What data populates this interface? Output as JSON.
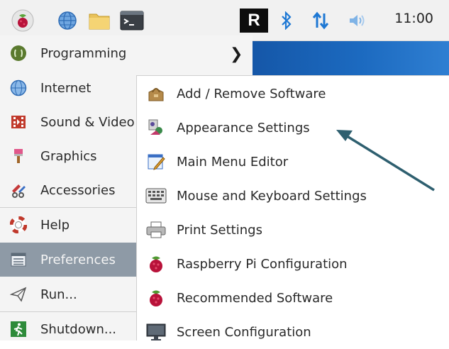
{
  "taskbar": {
    "clock": "11:00",
    "icons": [
      "raspberry-menu-icon",
      "web-browser-icon",
      "file-manager-icon",
      "terminal-icon",
      "realvnc-icon",
      "bluetooth-icon",
      "network-icon",
      "volume-icon"
    ],
    "vnc_label": "R"
  },
  "main_menu": {
    "items": [
      {
        "label": "Programming",
        "icon": "programming-icon"
      },
      {
        "label": "Internet",
        "icon": "globe-icon"
      },
      {
        "label": "Sound & Video",
        "icon": "sound-video-icon"
      },
      {
        "label": "Graphics",
        "icon": "paintbrush-icon"
      },
      {
        "label": "Accessories",
        "icon": "accessories-icon"
      },
      {
        "label": "Help",
        "icon": "lifebuoy-icon"
      },
      {
        "label": "Preferences",
        "icon": "preferences-icon"
      },
      {
        "label": "Run...",
        "icon": "paper-plane-icon"
      },
      {
        "label": "Shutdown...",
        "icon": "shutdown-icon"
      }
    ],
    "submenu_arrow": "❯"
  },
  "submenu": {
    "items": [
      {
        "label": "Add / Remove Software",
        "icon": "package-icon"
      },
      {
        "label": "Appearance Settings",
        "icon": "appearance-icon"
      },
      {
        "label": "Main Menu Editor",
        "icon": "menu-editor-icon"
      },
      {
        "label": "Mouse and Keyboard Settings",
        "icon": "keyboard-icon"
      },
      {
        "label": "Print Settings",
        "icon": "printer-icon"
      },
      {
        "label": "Raspberry Pi Configuration",
        "icon": "raspberry-icon"
      },
      {
        "label": "Recommended Software",
        "icon": "raspberry-icon"
      },
      {
        "label": "Screen Configuration",
        "icon": "monitor-icon"
      }
    ]
  },
  "colors": {
    "selected_bg": "#8e9aa6",
    "annotation_arrow": "#2e5f6f",
    "wallpaper": "#1c6ac0"
  }
}
